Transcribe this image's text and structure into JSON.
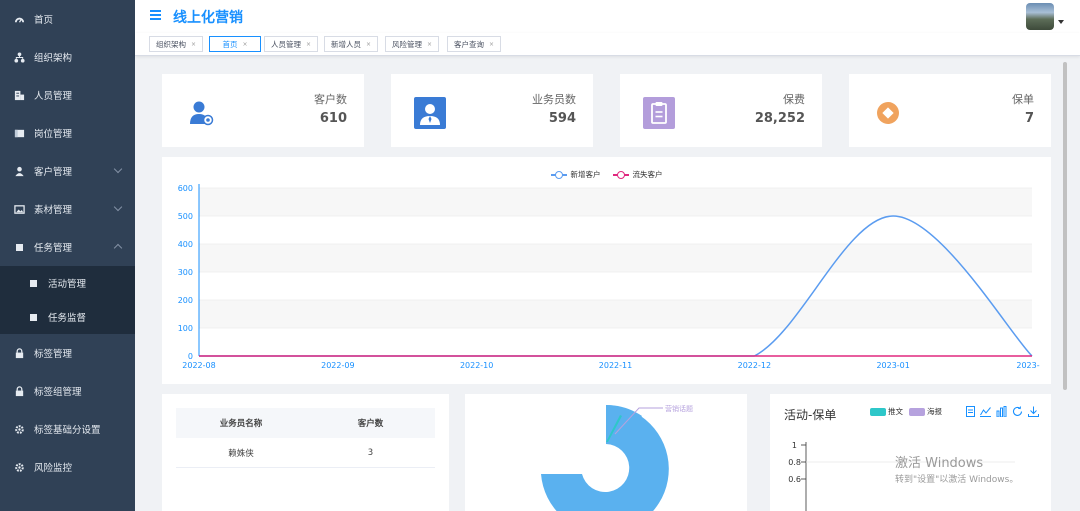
{
  "sidebar": {
    "items": [
      {
        "label": "首页",
        "icon": "dashboard-icon"
      },
      {
        "label": "组织架构",
        "icon": "tree-icon"
      },
      {
        "label": "人员管理",
        "icon": "people-icon"
      },
      {
        "label": "岗位管理",
        "icon": "post-icon"
      },
      {
        "label": "客户管理",
        "icon": "user-icon"
      },
      {
        "label": "素材管理",
        "icon": "image-icon"
      },
      {
        "label": "任务管理",
        "icon": "task-icon"
      },
      {
        "label": "活动管理",
        "icon": "square-icon"
      },
      {
        "label": "任务监督",
        "icon": "square-icon"
      },
      {
        "label": "标签管理",
        "icon": "lock-icon"
      },
      {
        "label": "标签组管理",
        "icon": "lock-icon"
      },
      {
        "label": "标签基础分设置",
        "icon": "gear-icon"
      },
      {
        "label": "风险监控",
        "icon": "gear-icon"
      }
    ]
  },
  "header": {
    "title": "线上化营销"
  },
  "tags": [
    "组织架构",
    "首页",
    "人员管理",
    "新增人员",
    "风险管理",
    "客户查询"
  ],
  "stats": [
    {
      "label": "客户数",
      "value": "610"
    },
    {
      "label": "业务员数",
      "value": "594"
    },
    {
      "label": "保费",
      "value": "28,252"
    },
    {
      "label": "保单",
      "value": "7"
    }
  ],
  "chart_data": [
    {
      "type": "line",
      "legend": [
        "新增客户",
        "流失客户"
      ],
      "x": [
        "2022-08",
        "2022-09",
        "2022-10",
        "2022-11",
        "2022-12",
        "2023-01",
        "2023-"
      ],
      "series": [
        {
          "name": "新增客户",
          "values": [
            0,
            0,
            0,
            0,
            0,
            500,
            0
          ],
          "color": "#5b9cf0"
        },
        {
          "name": "流失客户",
          "values": [
            0,
            0,
            0,
            0,
            0,
            0,
            0
          ],
          "color": "#e0287f"
        }
      ],
      "yticks": [
        0,
        100,
        200,
        300,
        400,
        500,
        600
      ],
      "ylim": [
        0,
        600
      ],
      "smooth": true
    },
    {
      "type": "pie",
      "labels": [
        "营销话题"
      ],
      "colors": [
        "#5ab1ef",
        "#2ec7c9"
      ]
    },
    {
      "type": "bar",
      "title": "活动-保单",
      "legend": [
        "推文",
        "海报"
      ],
      "colors": [
        "#2ec7c9",
        "#b6a2de"
      ],
      "yticks": [
        "1",
        "0.8",
        "0.6"
      ]
    }
  ],
  "table": {
    "headers": [
      "业务员名称",
      "客户数"
    ],
    "rows": [
      [
        "赖姝侠",
        "3"
      ]
    ]
  },
  "watermark": {
    "line1": "激活 Windows",
    "line2": "转到\"设置\"以激活 Windows。"
  },
  "colors": {
    "sidebar": "#304156",
    "submenu": "#1f2d3d",
    "accent": "#1890ff"
  }
}
